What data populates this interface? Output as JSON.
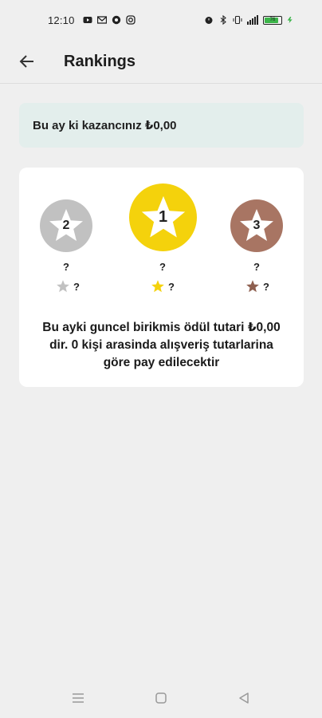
{
  "status_bar": {
    "time": "12:10",
    "left_icons": [
      "youtube-icon",
      "mail-icon",
      "app-icon",
      "instagram-icon"
    ],
    "right_icons": [
      "alarm-icon",
      "bluetooth-icon",
      "vibrate-icon",
      "signal-icon",
      "battery-icon",
      "charging-icon"
    ],
    "battery_level": "76"
  },
  "app_bar": {
    "title": "Rankings",
    "back_icon": "arrow-left-icon"
  },
  "earnings": {
    "text": "Bu ay ki kazancınız ₺0,00",
    "background": "#e3eeec"
  },
  "podium": [
    {
      "rank": "2",
      "name": "?",
      "score": "?",
      "color": "#c1c1c1"
    },
    {
      "rank": "1",
      "name": "?",
      "score": "?",
      "color": "#f4d20c"
    },
    {
      "rank": "3",
      "name": "?",
      "score": "?",
      "color": "#a87563"
    }
  ],
  "info_text": "Bu ayki guncel birikmis ödül tutari ₺0,00 dir. 0 kişi arasinda alışveriş tutarlarina göre pay edilecektir",
  "nav_bar": {
    "icons": [
      "menu-icon",
      "home-square-icon",
      "back-triangle-icon"
    ]
  }
}
